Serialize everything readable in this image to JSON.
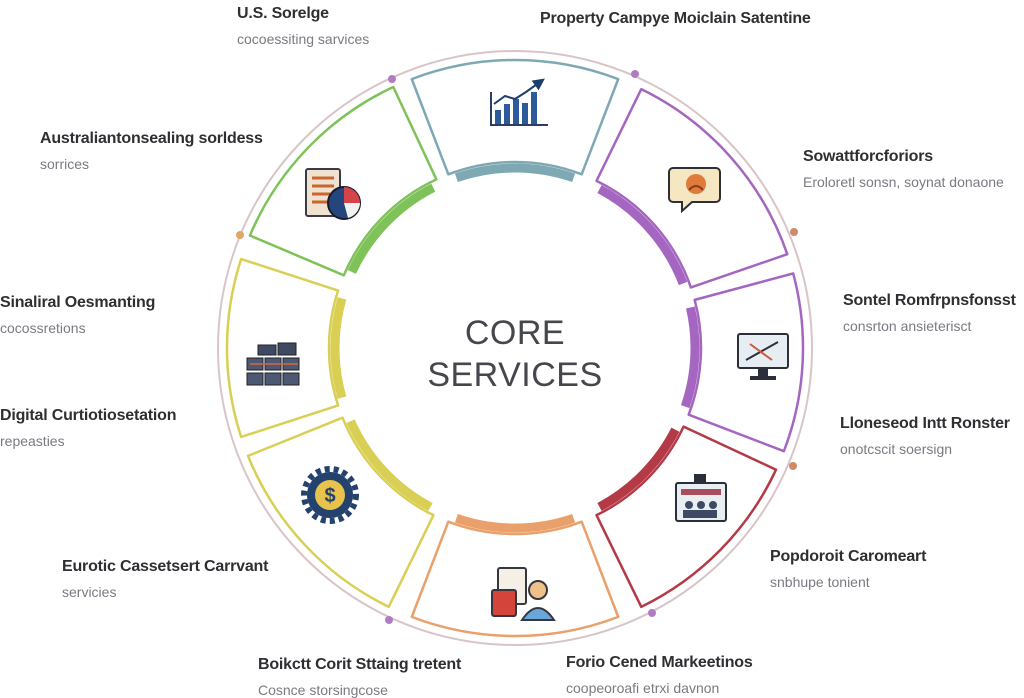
{
  "center": {
    "line1": "CORE",
    "line2": "SERVICES"
  },
  "colors": {
    "ring": "#d9c4c7",
    "teal": "#7ea8b3",
    "purple": "#a466c0",
    "red": "#b33a46",
    "orange": "#e9a06a",
    "yellow": "#d9cf55",
    "green": "#7fc25a"
  },
  "labels": [
    {
      "title": "U.S. Sorelge",
      "subtitle": "cocoessiting sarvices"
    },
    {
      "title": "Property Campye Moiclain Satentine",
      "subtitle": ""
    },
    {
      "title": "Australiantonsealing sorldess",
      "subtitle": "sorrices"
    },
    {
      "title": "Sowattforcforiors",
      "subtitle": "Eroloretl sonsn, soynat donaone"
    },
    {
      "title": "Sinaliral Oesmanting",
      "subtitle": "cocossretions"
    },
    {
      "title": "Sontel Romfrpnsfonsst",
      "subtitle": "consrton ansieterisct"
    },
    {
      "title": "Digital Curtiotiosetation",
      "subtitle": "repeasties"
    },
    {
      "title": "Lloneseod Intt Ronster",
      "subtitle": "onotcscit soersign"
    },
    {
      "title": "Eurotic Cassetsert Carrvant",
      "subtitle": "servicies"
    },
    {
      "title": "Popdoroit Caromeart",
      "subtitle": "snbhupe tonient"
    },
    {
      "title": "Boikctt Corit Sttaing tretent",
      "subtitle": "Cosnce storsingcose"
    },
    {
      "title": "Forio Cened Markeetinos",
      "subtitle": "coopeoroafi etrxi davnon"
    }
  ]
}
